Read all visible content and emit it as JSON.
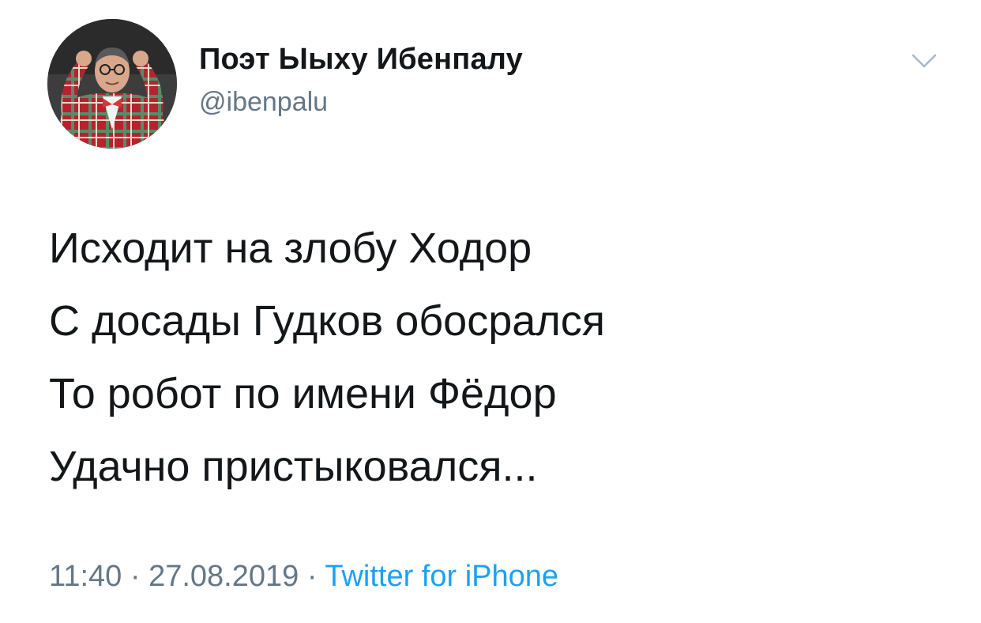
{
  "tweet": {
    "author": {
      "display_name": "Поэт Ыыху Ибенпалу",
      "handle": "@ibenpalu",
      "avatar_icon": "profile-photo"
    },
    "menu_icon": "chevron-down-icon",
    "text_lines": [
      "Исходит на злобу Ходор",
      "С досады Гудков обосрался",
      "То робот по имени Фёдор",
      "Удачно пристыковался..."
    ],
    "time": "11:40",
    "date": "27.08.2019",
    "separator": "·",
    "source": "Twitter for iPhone"
  },
  "colors": {
    "text_primary": "#14171a",
    "text_secondary": "#657786",
    "link": "#1da1f2",
    "chevron": "#aab8c2",
    "background": "#ffffff"
  }
}
